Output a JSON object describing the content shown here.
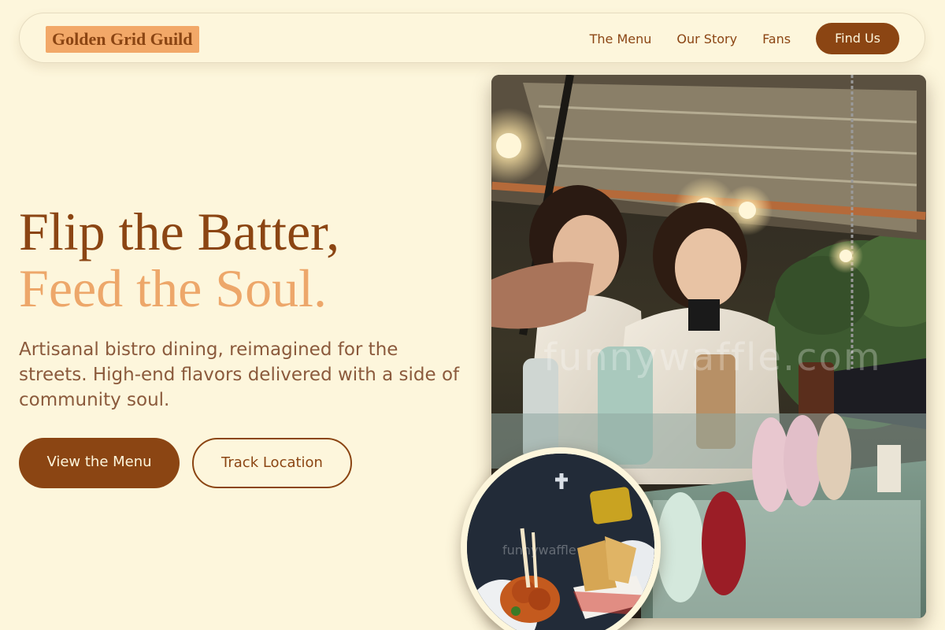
{
  "brand": {
    "name": "Golden Grid Guild"
  },
  "nav": {
    "links": [
      {
        "label": "The Menu"
      },
      {
        "label": "Our Story"
      },
      {
        "label": "Fans"
      }
    ],
    "cta_label": "Find Us"
  },
  "hero": {
    "title_line1": "Flip the Batter,",
    "title_line2": "Feed the Soul.",
    "subtitle": "Artisanal bistro dining, reimagined for the streets. High-end flavors delivered with a side of community soul.",
    "primary_button": "View the Menu",
    "secondary_button": "Track Location"
  },
  "images": {
    "main_photo_watermark": "funnywaffle.com",
    "round_photo_watermark": "funnywaffle"
  },
  "colors": {
    "background": "#fdf6dc",
    "brand_brown": "#8b4513",
    "accent_orange": "#eda76a",
    "brand_badge": "#f2a868",
    "body_text": "#8b5a3c"
  }
}
